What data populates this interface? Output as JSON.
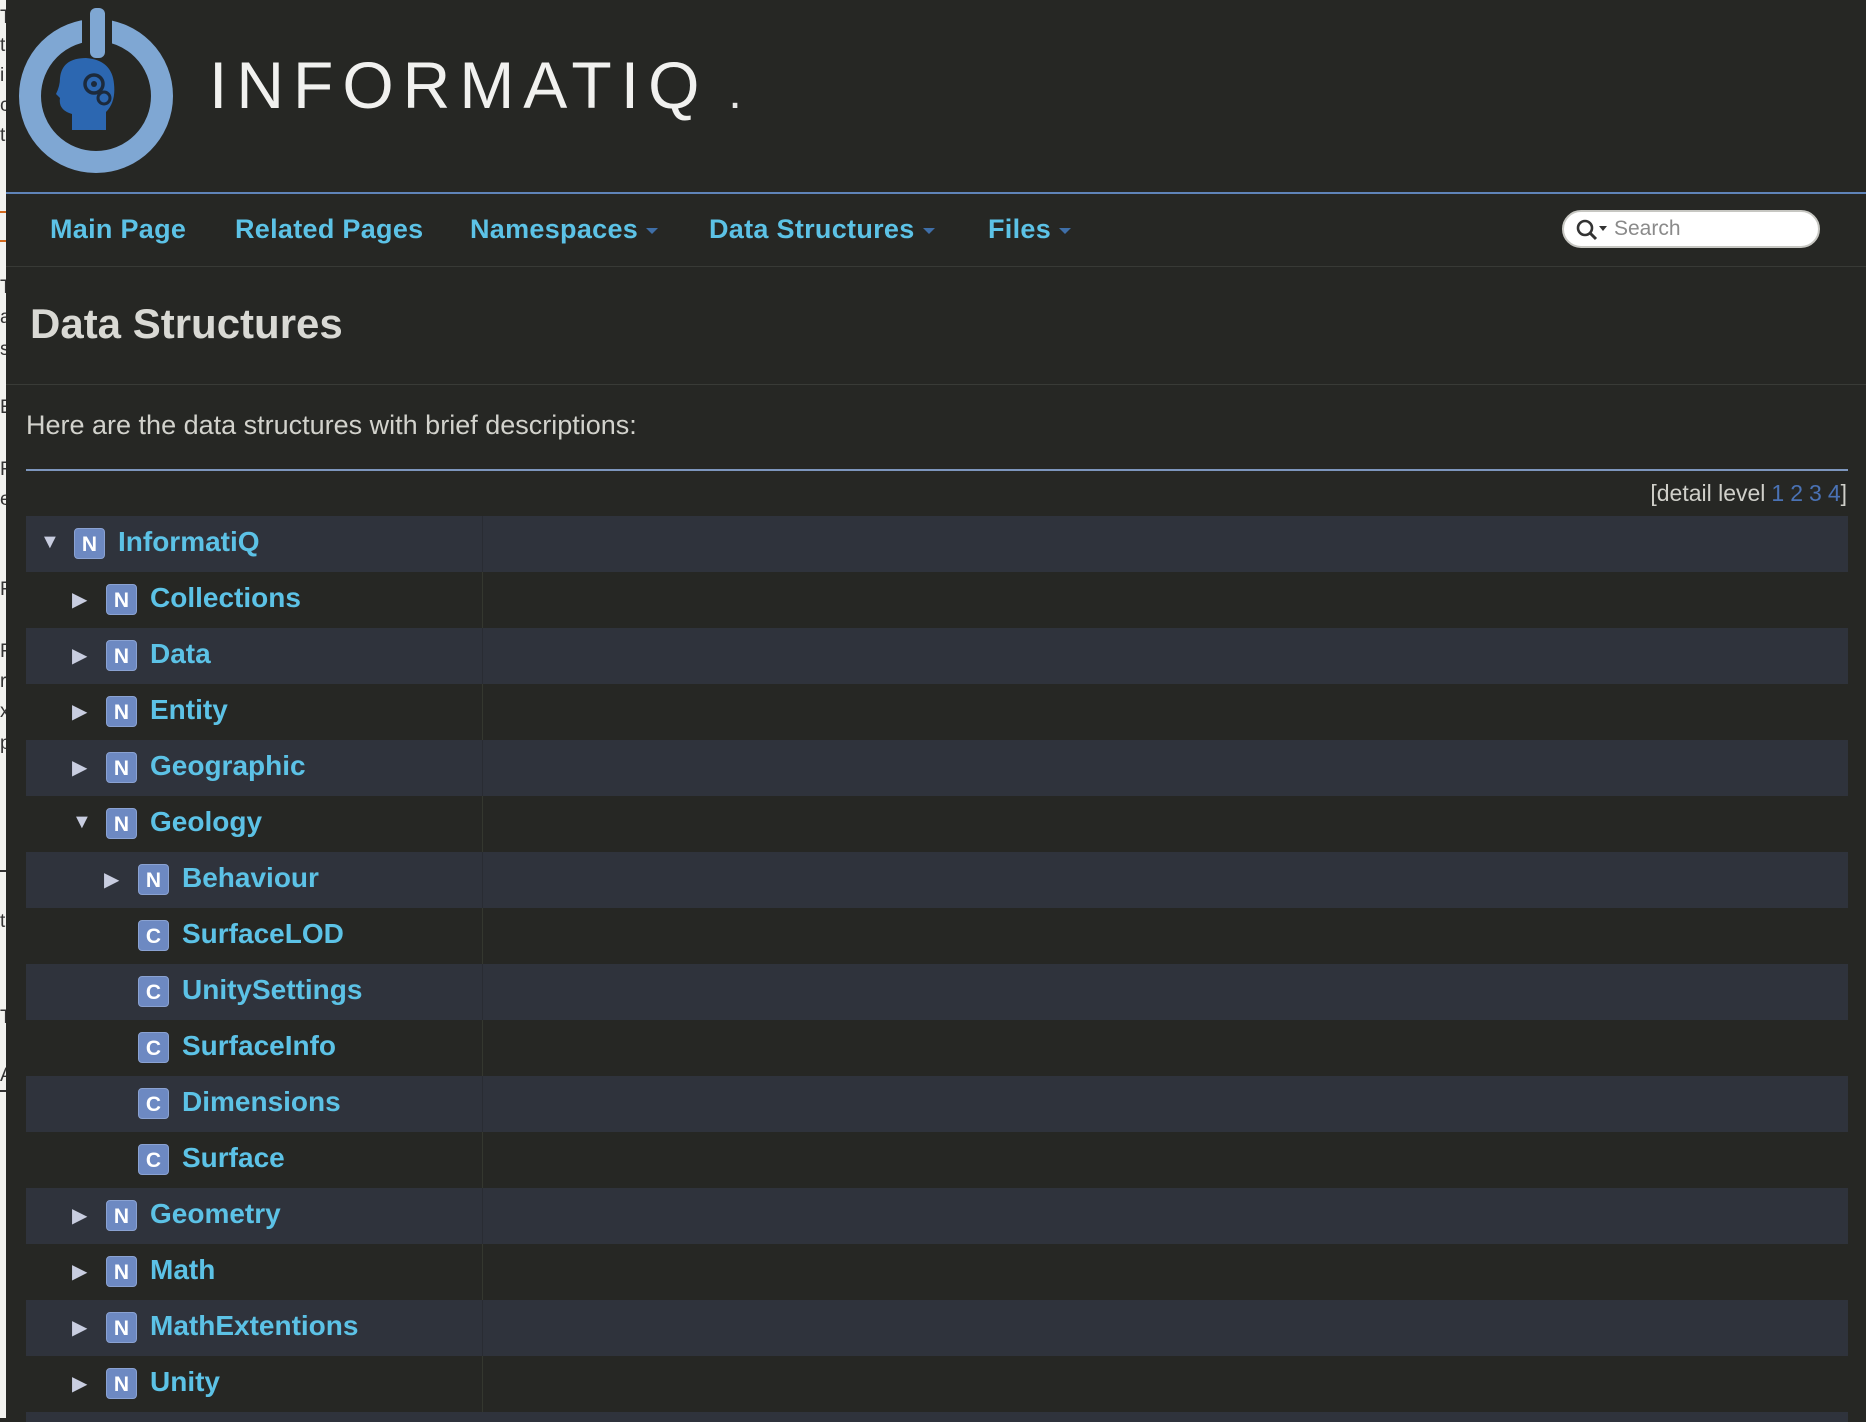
{
  "brand": {
    "name": "INFORMATIQ",
    "dot": "."
  },
  "nav": {
    "items": [
      {
        "label": "Main Page",
        "dropdown": false
      },
      {
        "label": "Related Pages",
        "dropdown": false
      },
      {
        "label": "Namespaces",
        "dropdown": true
      },
      {
        "label": "Data Structures",
        "dropdown": true
      },
      {
        "label": "Files",
        "dropdown": true
      }
    ],
    "search_placeholder": "Search"
  },
  "page": {
    "title": "Data Structures",
    "intro": "Here are the data structures with brief descriptions:",
    "detail_level_label": "[detail level",
    "detail_levels": [
      "1",
      "2",
      "3",
      "4"
    ],
    "detail_close": "]"
  },
  "tree": [
    {
      "label": "InformatiQ",
      "kind": "N",
      "depth": 0,
      "toggle": "expanded"
    },
    {
      "label": "Collections",
      "kind": "N",
      "depth": 1,
      "toggle": "collapsed"
    },
    {
      "label": "Data",
      "kind": "N",
      "depth": 1,
      "toggle": "collapsed"
    },
    {
      "label": "Entity",
      "kind": "N",
      "depth": 1,
      "toggle": "collapsed"
    },
    {
      "label": "Geographic",
      "kind": "N",
      "depth": 1,
      "toggle": "collapsed"
    },
    {
      "label": "Geology",
      "kind": "N",
      "depth": 1,
      "toggle": "expanded"
    },
    {
      "label": "Behaviour",
      "kind": "N",
      "depth": 2,
      "toggle": "collapsed"
    },
    {
      "label": "SurfaceLOD",
      "kind": "C",
      "depth": 2,
      "toggle": "none"
    },
    {
      "label": "UnitySettings",
      "kind": "C",
      "depth": 2,
      "toggle": "none"
    },
    {
      "label": "SurfaceInfo",
      "kind": "C",
      "depth": 2,
      "toggle": "none"
    },
    {
      "label": "Dimensions",
      "kind": "C",
      "depth": 2,
      "toggle": "none"
    },
    {
      "label": "Surface",
      "kind": "C",
      "depth": 2,
      "toggle": "none"
    },
    {
      "label": "Geometry",
      "kind": "N",
      "depth": 1,
      "toggle": "collapsed"
    },
    {
      "label": "Math",
      "kind": "N",
      "depth": 1,
      "toggle": "collapsed"
    },
    {
      "label": "MathExtentions",
      "kind": "N",
      "depth": 1,
      "toggle": "collapsed"
    },
    {
      "label": "Unity",
      "kind": "N",
      "depth": 1,
      "toggle": "collapsed"
    }
  ],
  "icons": {
    "expanded": "triangle-down-icon",
    "collapsed": "triangle-right-icon",
    "search": "search-icon"
  },
  "colors": {
    "background": "#262724",
    "link": "#5cc2e6",
    "badge": "#6d89c2",
    "alt_row": "#2f333c",
    "header_rule": "#5f84b9"
  }
}
